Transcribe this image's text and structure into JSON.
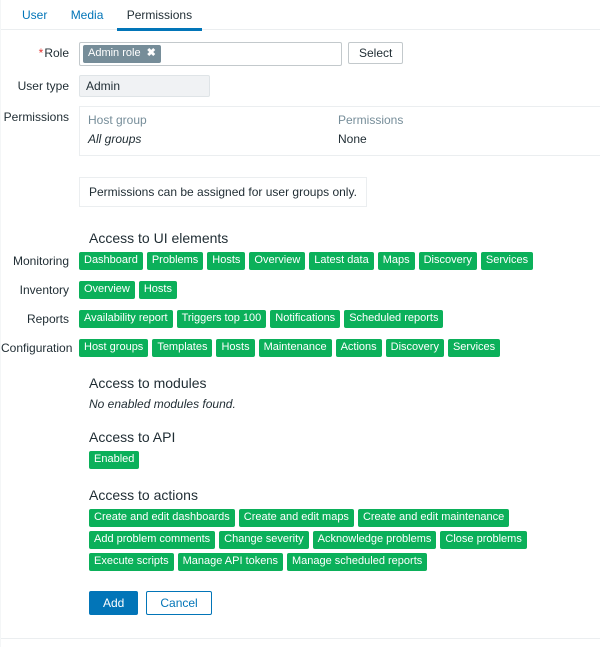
{
  "tabs": [
    {
      "label": "User",
      "active": false
    },
    {
      "label": "Media",
      "active": false
    },
    {
      "label": "Permissions",
      "active": true
    }
  ],
  "form": {
    "role": {
      "label": "Role",
      "required_marker": "*",
      "chip_value": "Admin role",
      "chip_remove_icon": "✖",
      "select_button": "Select"
    },
    "user_type": {
      "label": "User type",
      "value": "Admin"
    },
    "permissions": {
      "label": "Permissions",
      "columns": [
        "Host group",
        "Permissions"
      ],
      "rows": [
        {
          "host_group": "All groups",
          "permission": "None"
        }
      ],
      "info_message": "Permissions can be assigned for user groups only."
    }
  },
  "ui_elements": {
    "heading": "Access to UI elements",
    "groups": [
      {
        "label": "Monitoring",
        "items": [
          "Dashboard",
          "Problems",
          "Hosts",
          "Overview",
          "Latest data",
          "Maps",
          "Discovery",
          "Services"
        ]
      },
      {
        "label": "Inventory",
        "items": [
          "Overview",
          "Hosts"
        ]
      },
      {
        "label": "Reports",
        "items": [
          "Availability report",
          "Triggers top 100",
          "Notifications",
          "Scheduled reports"
        ]
      },
      {
        "label": "Configuration",
        "items": [
          "Host groups",
          "Templates",
          "Hosts",
          "Maintenance",
          "Actions",
          "Discovery",
          "Services"
        ]
      }
    ]
  },
  "modules": {
    "heading": "Access to modules",
    "note": "No enabled modules found."
  },
  "api": {
    "heading": "Access to API",
    "items": [
      "Enabled"
    ]
  },
  "actions": {
    "heading": "Access to actions",
    "items": [
      "Create and edit dashboards",
      "Create and edit maps",
      "Create and edit maintenance",
      "Add problem comments",
      "Change severity",
      "Acknowledge problems",
      "Close problems",
      "Execute scripts",
      "Manage API tokens",
      "Manage scheduled reports"
    ]
  },
  "footer": {
    "submit": "Add",
    "cancel": "Cancel"
  },
  "colors": {
    "accent": "#0275b8",
    "badge_green": "#0bb05a",
    "chip_gray": "#768d99",
    "required_red": "#e33734"
  }
}
